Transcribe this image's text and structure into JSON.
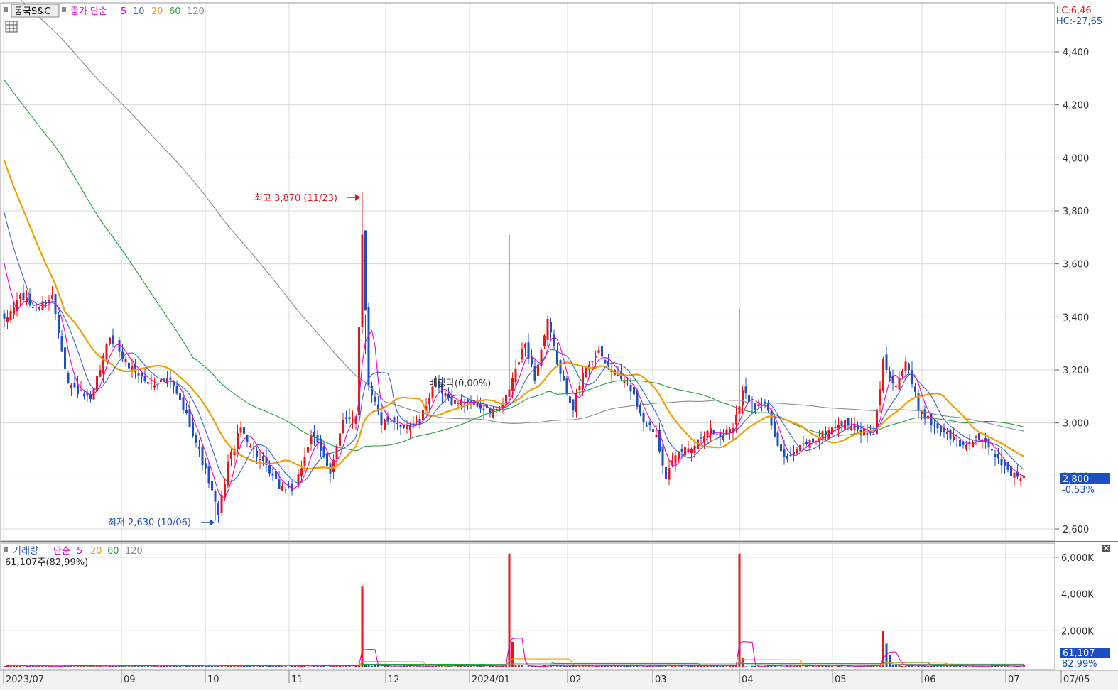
{
  "header": {
    "stock_name": "동국S&C",
    "price_ind": "종가 단순",
    "ma_periods": [
      "5",
      "10",
      "20",
      "60",
      "120"
    ],
    "lc_text": "LC:6,46",
    "hc_text": "HC:-27,65"
  },
  "annotations": {
    "high_text": "최고 3,870 (11/23)",
    "low_text": "최저 2,630 (10/06)",
    "dividend_text": "배당락(0,00%)"
  },
  "last_price": {
    "value": "2,800",
    "change": "-0,53%"
  },
  "volume_header": {
    "label": "거래량",
    "ind": "단순",
    "ma_periods": [
      "5",
      "20",
      "60",
      "120"
    ],
    "current": "61,107주(82,99%)"
  },
  "last_volume": {
    "value": "61,107",
    "pct": "82,99%"
  },
  "colors": {
    "up": "#e8151b",
    "down": "#1d4fc4",
    "ma5": "#ee00cc",
    "ma10": "#3b62e0",
    "ma20": "#f0a000",
    "ma60": "#22a13a",
    "ma120": "#8c8c8c",
    "grid": "#d9d9d9"
  },
  "chart_data": [
    {
      "type": "candlestick",
      "title": "동국S&C",
      "ylim": [
        2560,
        4600
      ],
      "y_ticks": [
        "4,400",
        "4,200",
        "4,000",
        "3,800",
        "3,600",
        "3,400",
        "3,200",
        "3,000",
        "2,800",
        "2,600"
      ],
      "y_tick_values": [
        4400,
        4200,
        4000,
        3800,
        3600,
        3400,
        3200,
        3000,
        2800,
        2600
      ],
      "x_tick_labels": [
        "2023/07",
        "09",
        "10",
        "11",
        "12",
        "2024/01",
        "02",
        "03",
        "04",
        "05",
        "06",
        "07",
        "07/05"
      ],
      "high": {
        "value": 3870,
        "date": "11/23"
      },
      "low": {
        "value": 2630,
        "date": "10/06"
      },
      "last_close": 2800,
      "price_anchors": [
        [
          0,
          3380
        ],
        [
          5,
          3480
        ],
        [
          10,
          3430
        ],
        [
          15,
          3480
        ],
        [
          20,
          3150
        ],
        [
          27,
          3080
        ],
        [
          33,
          3330
        ],
        [
          38,
          3230
        ],
        [
          45,
          3150
        ],
        [
          52,
          3160
        ],
        [
          58,
          3000
        ],
        [
          64,
          2780
        ],
        [
          67,
          2650
        ],
        [
          70,
          2850
        ],
        [
          74,
          2980
        ],
        [
          80,
          2860
        ],
        [
          86,
          2760
        ],
        [
          91,
          2750
        ],
        [
          96,
          2960
        ],
        [
          102,
          2820
        ],
        [
          106,
          3000
        ],
        [
          110,
          3030
        ],
        [
          112,
          3710
        ],
        [
          114,
          3150
        ],
        [
          118,
          3000
        ],
        [
          124,
          2990
        ],
        [
          130,
          3000
        ],
        [
          134,
          3140
        ],
        [
          140,
          3080
        ],
        [
          146,
          3080
        ],
        [
          152,
          3040
        ],
        [
          156,
          3060
        ],
        [
          160,
          3200
        ],
        [
          163,
          3300
        ],
        [
          166,
          3170
        ],
        [
          170,
          3380
        ],
        [
          174,
          3180
        ],
        [
          178,
          3060
        ],
        [
          182,
          3220
        ],
        [
          186,
          3260
        ],
        [
          190,
          3200
        ],
        [
          196,
          3130
        ],
        [
          200,
          3010
        ],
        [
          204,
          2960
        ],
        [
          207,
          2800
        ],
        [
          211,
          2890
        ],
        [
          216,
          2920
        ],
        [
          220,
          2980
        ],
        [
          224,
          2950
        ],
        [
          228,
          2990
        ],
        [
          231,
          3120
        ],
        [
          235,
          3060
        ],
        [
          238,
          3080
        ],
        [
          242,
          2900
        ],
        [
          246,
          2870
        ],
        [
          250,
          2920
        ],
        [
          254,
          2940
        ],
        [
          260,
          2990
        ],
        [
          264,
          3000
        ],
        [
          268,
          2970
        ],
        [
          272,
          2950
        ],
        [
          275,
          3230
        ],
        [
          279,
          3140
        ],
        [
          282,
          3230
        ],
        [
          286,
          3060
        ],
        [
          290,
          3000
        ],
        [
          296,
          2950
        ],
        [
          300,
          2910
        ],
        [
          304,
          2950
        ],
        [
          308,
          2900
        ],
        [
          312,
          2850
        ],
        [
          316,
          2800
        ]
      ],
      "spikes": [
        {
          "index": 112,
          "high": 3870
        },
        {
          "index": 113,
          "high": 3260
        },
        {
          "index": 158,
          "high": 3710
        },
        {
          "index": 230,
          "high": 3430
        }
      ],
      "ma_start": {
        "ma5": 3620,
        "ma10": 3780,
        "ma20": 3940,
        "ma60": 4190,
        "ma120": 4500
      }
    },
    {
      "type": "bar",
      "title": "거래량",
      "unit": "K",
      "ylim": [
        0,
        6800
      ],
      "y_ticks": [
        "6,000K",
        "4,000K",
        "2,000K"
      ],
      "y_tick_values": [
        6000,
        4000,
        2000
      ],
      "spikes": [
        {
          "index": 112,
          "value": 4400
        },
        {
          "index": 158,
          "value": 6200
        },
        {
          "index": 159,
          "value": 1400
        },
        {
          "index": 230,
          "value": 6200
        },
        {
          "index": 231,
          "value": 500
        },
        {
          "index": 275,
          "value": 2000
        },
        {
          "index": 276,
          "value": 1300
        },
        {
          "index": 277,
          "value": 700
        }
      ],
      "last_volume": 61.107
    }
  ]
}
